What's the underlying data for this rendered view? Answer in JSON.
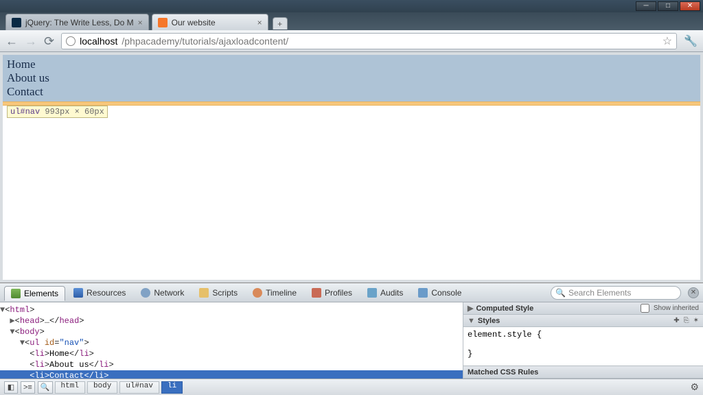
{
  "window": {
    "min": "─",
    "max": "□",
    "close": "✕"
  },
  "tabs": [
    {
      "label": "jQuery: The Write Less, Do M",
      "closable": true,
      "klass": "inactive",
      "fav": "jq"
    },
    {
      "label": "Our website",
      "closable": true,
      "klass": "",
      "fav": "xa"
    }
  ],
  "address": {
    "host": "localhost",
    "path": "/phpacademy/tutorials/ajaxloadcontent/"
  },
  "nav_items": [
    "Home",
    "About us",
    "Contact"
  ],
  "inspect_tooltip": {
    "selector": "ul#nav",
    "dims": "993px × 60px"
  },
  "devtools": {
    "tabs": [
      "Elements",
      "Resources",
      "Network",
      "Scripts",
      "Timeline",
      "Profiles",
      "Audits",
      "Console"
    ],
    "search_placeholder": "Search Elements",
    "computed_label": "Computed Style",
    "show_inherited": "Show inherited",
    "styles_label": "Styles",
    "element_style_open": "element.style {",
    "element_style_close": "}",
    "matched_label": "Matched CSS Rules",
    "breadcrumbs": [
      "html",
      "body",
      "ul#nav",
      "li"
    ],
    "dom_lines": {
      "l0": "▼<html>",
      "l1": "  ▶<head>…</head>",
      "l2": "  ▼<body>",
      "l3": "    ▼<ul id=\"nav\">",
      "l4": "      <li>Home</li>",
      "l5": "      <li>About us</li>",
      "l6": "      <li>Contact</li>"
    }
  }
}
